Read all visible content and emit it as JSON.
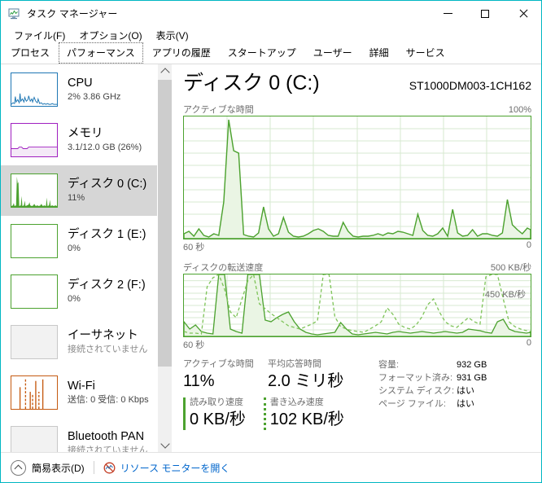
{
  "window": {
    "title": "タスク マネージャー",
    "icon": "task-manager-icon",
    "border_color": "#00b7c3",
    "buttons": {
      "minimize": "—",
      "maximize": "□",
      "close": "✕"
    }
  },
  "menu": [
    {
      "label": "ファイル(F)"
    },
    {
      "label": "オプション(O)"
    },
    {
      "label": "表示(V)"
    }
  ],
  "tabs": [
    {
      "label": "プロセス",
      "selected": false
    },
    {
      "label": "パフォーマンス",
      "selected": true
    },
    {
      "label": "アプリの履歴",
      "selected": false
    },
    {
      "label": "スタートアップ",
      "selected": false
    },
    {
      "label": "ユーザー",
      "selected": false
    },
    {
      "label": "詳細",
      "selected": false
    },
    {
      "label": "サービス",
      "selected": false
    }
  ],
  "sidebar": {
    "items": [
      {
        "title": "CPU",
        "sub": "2%  3.86 GHz",
        "color": "#1f77b4",
        "selected": false,
        "muted": false
      },
      {
        "title": "メモリ",
        "sub": "3.1/12.0 GB (26%)",
        "color": "#a020c0",
        "selected": false,
        "muted": false
      },
      {
        "title": "ディスク 0 (C:)",
        "sub": "11%",
        "color": "#4ca22f",
        "selected": true,
        "muted": false
      },
      {
        "title": "ディスク 1 (E:)",
        "sub": "0%",
        "color": "#4ca22f",
        "selected": false,
        "muted": false
      },
      {
        "title": "ディスク 2 (F:)",
        "sub": "0%",
        "color": "#4ca22f",
        "selected": false,
        "muted": false
      },
      {
        "title": "イーサネット",
        "sub": "接続されていません",
        "color": "#b0b0b0",
        "selected": false,
        "muted": true
      },
      {
        "title": "Wi-Fi",
        "sub": "送信: 0 受信: 0 Kbps",
        "color": "#c55a11",
        "selected": false,
        "muted": false
      },
      {
        "title": "Bluetooth PAN",
        "sub": "接続されていません",
        "color": "#b0b0b0",
        "selected": false,
        "muted": true
      }
    ],
    "scroll": {
      "up": "chevron-up-icon",
      "down": "chevron-down-icon"
    }
  },
  "main": {
    "title": "ディスク 0 (C:)",
    "model": "ST1000DM003-1CH162",
    "accent_color": "#4ca22f",
    "graph_active": {
      "label": "アクティブな時間",
      "max_label": "100%",
      "left_time": "60 秒",
      "right_time": "0"
    },
    "graph_transfer": {
      "label": "ディスクの転送速度",
      "max_label": "500 KB/秒",
      "annotation": "450 KB/秒",
      "left_time": "60 秒",
      "right_time": "0"
    },
    "stats": {
      "active_time": {
        "label": "アクティブな時間",
        "value": "11%"
      },
      "avg_response": {
        "label": "平均応答時間",
        "value": "2.0 ミリ秒"
      },
      "read_speed": {
        "label": "読み取り速度",
        "value": "0 KB/秒"
      },
      "write_speed": {
        "label": "書き込み速度",
        "value": "102 KB/秒"
      }
    },
    "info": [
      {
        "key": "容量:",
        "value": "932 GB"
      },
      {
        "key": "フォーマット済み:",
        "value": "931 GB"
      },
      {
        "key": "システム ディスク:",
        "value": "はい"
      },
      {
        "key": "ページ ファイル:",
        "value": "はい"
      }
    ]
  },
  "statusbar": {
    "fewer_details": "簡易表示(D)",
    "resource_monitor": "リソース モニターを開く",
    "collapse_icon": "chevron-up-circle-icon",
    "monitor_icon": "resource-monitor-icon"
  },
  "chart_data": [
    {
      "type": "area",
      "title": "アクティブな時間",
      "ylabel": "%",
      "xlabel": "秒",
      "ylim": [
        0,
        100
      ],
      "xlim": [
        60,
        0
      ],
      "grid": true,
      "line_color": "#4ca22f",
      "fill_color": "#eaf5e4",
      "series": [
        {
          "name": "アクティブな時間",
          "values": [
            4,
            2,
            9,
            3,
            1,
            2,
            4,
            3,
            30,
            97,
            72,
            70,
            5,
            3,
            2,
            5,
            26,
            8,
            3,
            4,
            17,
            5,
            2,
            1,
            2,
            4,
            7,
            8,
            6,
            3,
            2,
            2,
            13,
            6,
            2,
            1,
            2,
            2,
            3,
            4,
            3,
            5,
            4,
            6,
            5,
            4,
            3,
            20,
            7,
            3,
            2,
            4,
            9,
            2,
            24,
            5,
            2,
            3,
            7,
            2,
            4,
            4,
            3,
            2,
            5,
            32,
            11,
            7,
            4,
            9
          ]
        }
      ]
    },
    {
      "type": "line",
      "title": "ディスクの転送速度",
      "ylabel": "KB/秒",
      "xlabel": "秒",
      "ylim": [
        0,
        500
      ],
      "xlim": [
        60,
        0
      ],
      "grid": true,
      "annotation": "450 KB/秒",
      "read_color": "#4ca22f",
      "write_color": "#7fc45a",
      "series": [
        {
          "name": "読み取り速度",
          "style": "solid",
          "values": [
            120,
            60,
            90,
            40,
            30,
            20,
            500,
            500,
            60,
            40,
            30,
            500,
            500,
            500,
            130,
            120,
            150,
            180,
            200,
            120,
            60,
            30,
            20,
            15,
            20,
            25,
            30,
            110,
            60,
            20,
            15,
            20,
            25,
            30,
            25,
            20,
            30,
            40,
            35,
            30,
            25,
            20,
            25,
            30,
            35,
            40,
            35,
            30,
            25,
            30,
            40,
            60,
            55,
            45,
            35,
            30,
            120,
            140,
            60,
            40
          ]
        },
        {
          "name": "書き込み速度",
          "style": "dotted",
          "values": [
            40,
            30,
            25,
            20,
            400,
            480,
            500,
            380,
            200,
            150,
            300,
            450,
            500,
            260,
            220,
            180,
            150,
            120,
            90,
            70,
            60,
            50,
            70,
            90,
            110,
            500,
            500,
            160,
            80,
            60,
            50,
            45,
            40,
            60,
            80,
            120,
            230,
            180,
            100,
            70,
            60,
            90,
            160,
            260,
            300,
            200,
            120,
            90,
            80,
            110,
            150,
            120,
            100,
            480,
            500,
            500,
            300,
            120,
            80,
            60
          ]
        }
      ]
    }
  ]
}
